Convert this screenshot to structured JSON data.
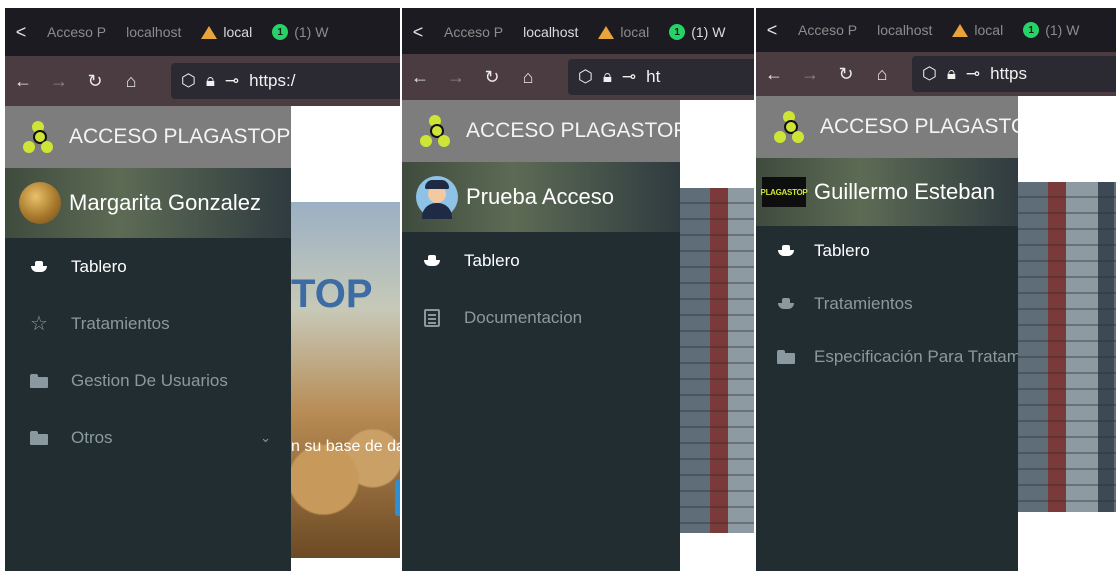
{
  "browser": {
    "back_glyph": "<",
    "tabs": {
      "acceso": "Acceso P",
      "localhost": "localhost",
      "local_m": "local",
      "whatsapp_badge": "1",
      "whatsapp": "(1) W"
    },
    "url_prefix": "https:/",
    "url_prefix_short": "ht",
    "url_prefix_third": "https"
  },
  "app": {
    "brand": "ACCESO PLAGASTOP",
    "logo_text": "PLAGASTOP",
    "accent_color": "#cfe536",
    "sidebar_color": "#222d32"
  },
  "panels": [
    {
      "user": "Margarita Gonzalez",
      "menu": [
        {
          "label": "Tablero",
          "icon": "ship-icon",
          "active": true
        },
        {
          "label": "Tratamientos",
          "icon": "star-icon",
          "active": false
        },
        {
          "label": "Gestion De Usuarios",
          "icon": "folder-icon",
          "active": false
        },
        {
          "label": "Otros",
          "icon": "folder-icon",
          "active": false,
          "expandable": true
        }
      ],
      "background_text": {
        "logo_fragment": "TOP",
        "message_fragment": "n su base de dat"
      }
    },
    {
      "user": "Prueba Acceso",
      "menu": [
        {
          "label": "Tablero",
          "icon": "ship-icon",
          "active": true
        },
        {
          "label": "Documentacion",
          "icon": "document-icon",
          "active": false
        }
      ]
    },
    {
      "user": "Guillermo Esteban",
      "menu": [
        {
          "label": "Tablero",
          "icon": "ship-icon",
          "active": true
        },
        {
          "label": "Tratamientos",
          "icon": "ship-icon",
          "active": false
        },
        {
          "label": "Especificación Para Tratami",
          "icon": "folder-icon",
          "active": false
        }
      ]
    }
  ]
}
